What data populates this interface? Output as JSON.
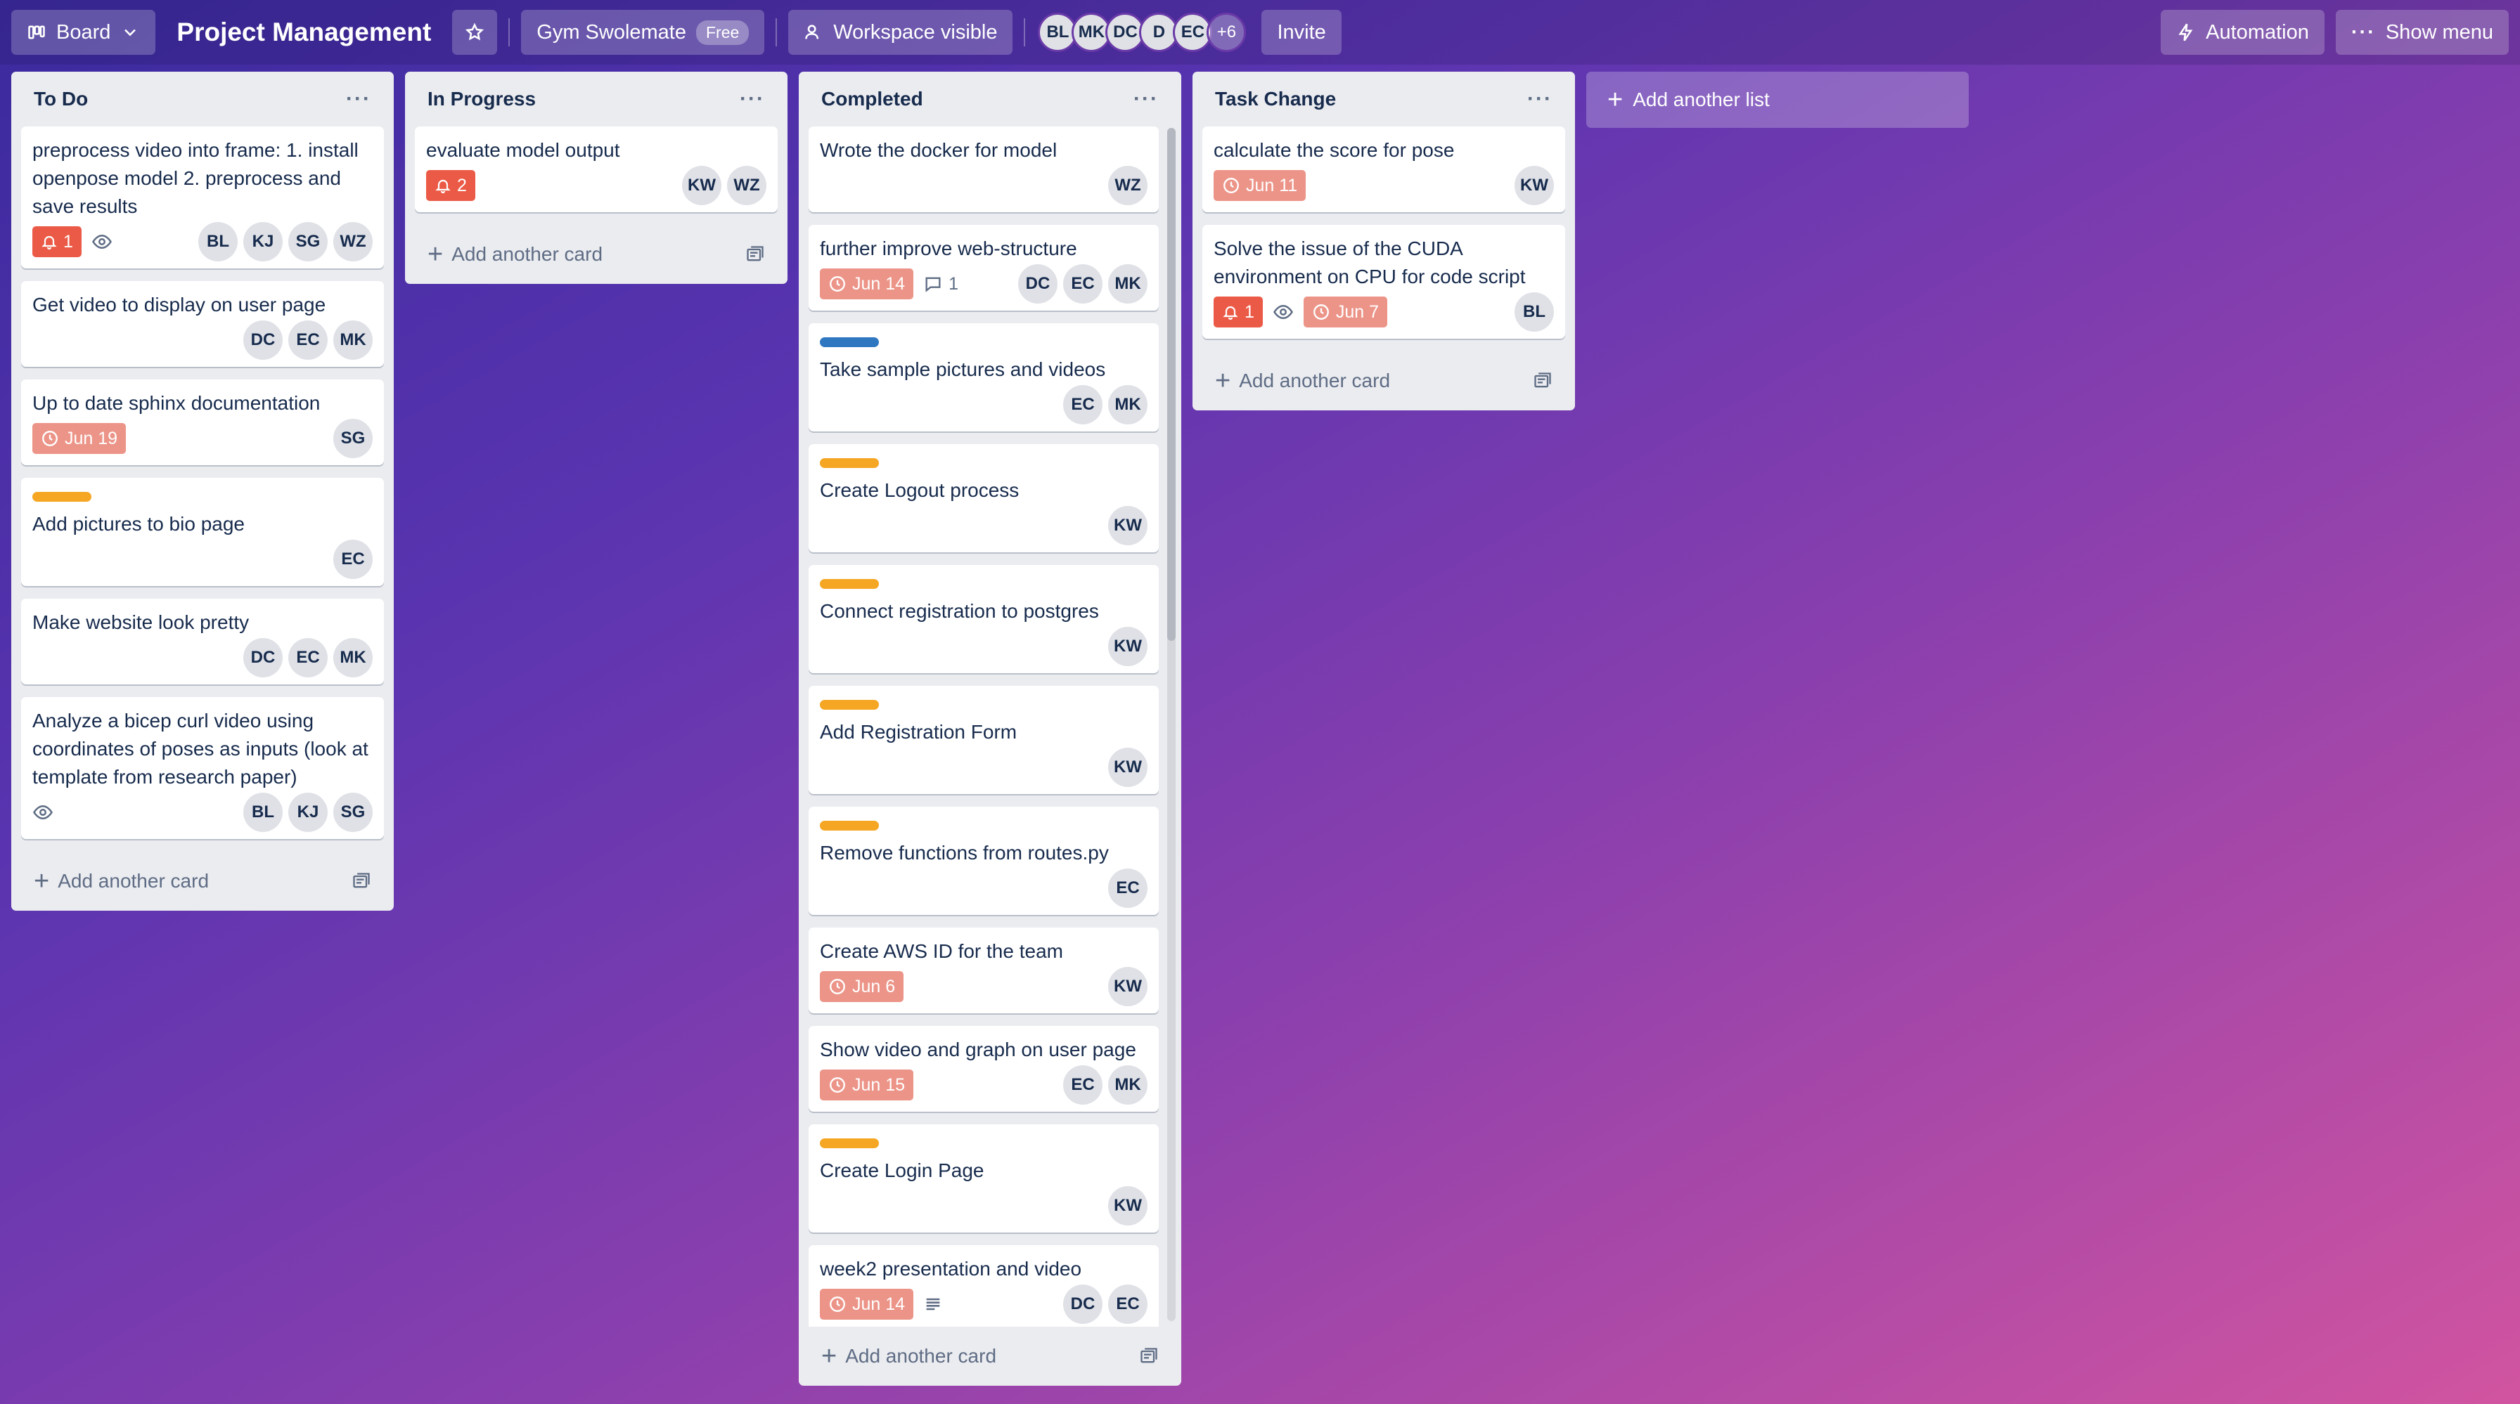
{
  "header": {
    "board_view": "Board",
    "title": "Project Management",
    "workspace": "Gym Swolemate",
    "workspace_plan": "Free",
    "visibility": "Workspace visible",
    "members": [
      "BL",
      "MK",
      "DC",
      "D",
      "EC"
    ],
    "more_members": "+6",
    "invite": "Invite",
    "automation": "Automation",
    "show_menu": "Show menu"
  },
  "lists": [
    {
      "name": "To Do",
      "add_card": "Add another card",
      "cards": [
        {
          "title": "preprocess video into frame: 1. install openpose model 2. preprocess and save results",
          "notif": "1",
          "watch": true,
          "members": [
            "BL",
            "KJ",
            "SG",
            "WZ"
          ]
        },
        {
          "title": "Get video to display on user page",
          "members": [
            "DC",
            "EC",
            "MK"
          ]
        },
        {
          "title": "Up to date sphinx documentation",
          "due": "Jun 19",
          "members": [
            "SG"
          ]
        },
        {
          "title": "Add pictures to bio page",
          "label": "#f5a623",
          "members": [
            "EC"
          ]
        },
        {
          "title": "Make website look pretty",
          "members": [
            "DC",
            "EC",
            "MK"
          ]
        },
        {
          "title": "Analyze a bicep curl video using coordinates of poses as inputs (look at template from research paper)",
          "watch": true,
          "members": [
            "BL",
            "KJ",
            "SG"
          ]
        }
      ]
    },
    {
      "name": "In Progress",
      "add_card": "Add another card",
      "cards": [
        {
          "title": "evaluate model output",
          "notif": "2",
          "members": [
            "KW",
            "WZ"
          ]
        }
      ]
    },
    {
      "name": "Completed",
      "add_card": "Add another card",
      "cards": [
        {
          "title": "Wrote the docker for model",
          "members": [
            "WZ"
          ]
        },
        {
          "title": "further improve web-structure",
          "due": "Jun 14",
          "comments": "1",
          "members": [
            "DC",
            "EC",
            "MK"
          ]
        },
        {
          "title": "Take sample pictures and videos",
          "label": "#2f77c1",
          "members": [
            "EC",
            "MK"
          ]
        },
        {
          "title": "Create Logout process",
          "label": "#f5a623",
          "members": [
            "KW"
          ]
        },
        {
          "title": "Connect registration to postgres",
          "label": "#f5a623",
          "members": [
            "KW"
          ]
        },
        {
          "title": "Add Registration Form",
          "label": "#f5a623",
          "members": [
            "KW"
          ]
        },
        {
          "title": "Remove functions from routes.py",
          "label": "#f5a623",
          "members": [
            "EC"
          ]
        },
        {
          "title": "Create AWS ID for the team",
          "due": "Jun 6",
          "members": [
            "KW"
          ]
        },
        {
          "title": "Show video and graph on user page",
          "due": "Jun 15",
          "members": [
            "EC",
            "MK"
          ]
        },
        {
          "title": "Create Login Page",
          "label": "#f5a623",
          "members": [
            "KW"
          ]
        },
        {
          "title": "week2 presentation and video",
          "due": "Jun 14",
          "description": true,
          "members": [
            "DC",
            "EC"
          ]
        }
      ]
    },
    {
      "name": "Task Change",
      "add_card": "Add another card",
      "cards": [
        {
          "title": "calculate the score for pose",
          "due": "Jun 11",
          "members": [
            "KW"
          ]
        },
        {
          "title": "Solve the issue of the CUDA environment on CPU for code script",
          "notif": "1",
          "watch": true,
          "due": "Jun 7",
          "members": [
            "BL"
          ]
        }
      ]
    }
  ],
  "add_list": "Add another list"
}
